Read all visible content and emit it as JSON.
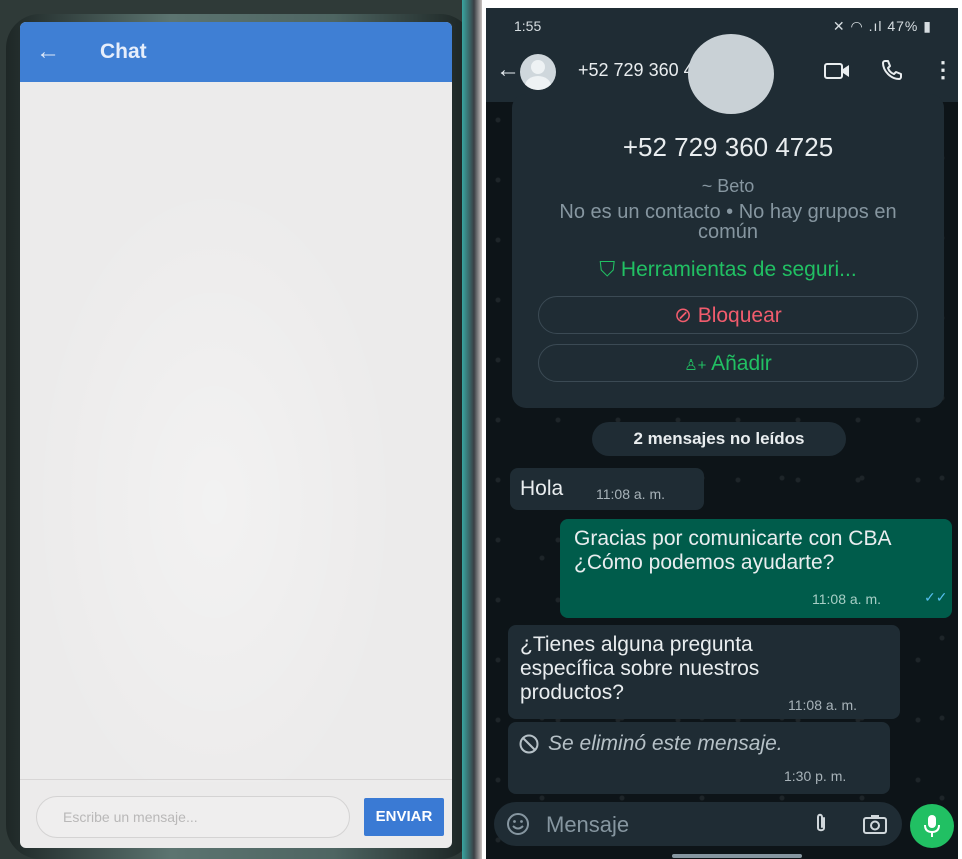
{
  "left_app": {
    "title": "Chat",
    "input_placeholder": "Escribe un mensaje...",
    "send_label": "ENVIAR",
    "accent_color": "#3f7fd4"
  },
  "status_bar": {
    "time": "1:55",
    "battery": "47%"
  },
  "whatsapp": {
    "header": {
      "contact": "+52 729 360 4725"
    },
    "info_card": {
      "phone": "+52 729 360 4725",
      "alias": "~ Beto",
      "status": "No es un contacto • No hay grupos en común",
      "security_link": "Herramientas de seguri...",
      "block_label": "Bloquear",
      "add_label": "Añadir"
    },
    "unread_banner": "2 mensajes no leídos",
    "messages": [
      {
        "direction": "in",
        "text": "Hola",
        "time": "11:08 a. m."
      },
      {
        "direction": "out",
        "text": "Gracias por comunicarte con CBA  ¿Cómo podemos ayudarte?",
        "time": "11:08 a. m."
      },
      {
        "direction": "in",
        "text": "¿Tienes alguna pregunta específica sobre nuestros productos?",
        "time": "11:08 a. m."
      },
      {
        "direction": "in",
        "text": "Se eliminó este mensaje.",
        "time": "1:30 p. m.",
        "deleted": true
      }
    ],
    "input_placeholder": "Mensaje",
    "colors": {
      "background": "#0d1418",
      "bar": "#1f2c34",
      "outgoing_bubble": "#005c4b",
      "accent_green": "#21c063",
      "block_red": "#f15c6d"
    }
  }
}
